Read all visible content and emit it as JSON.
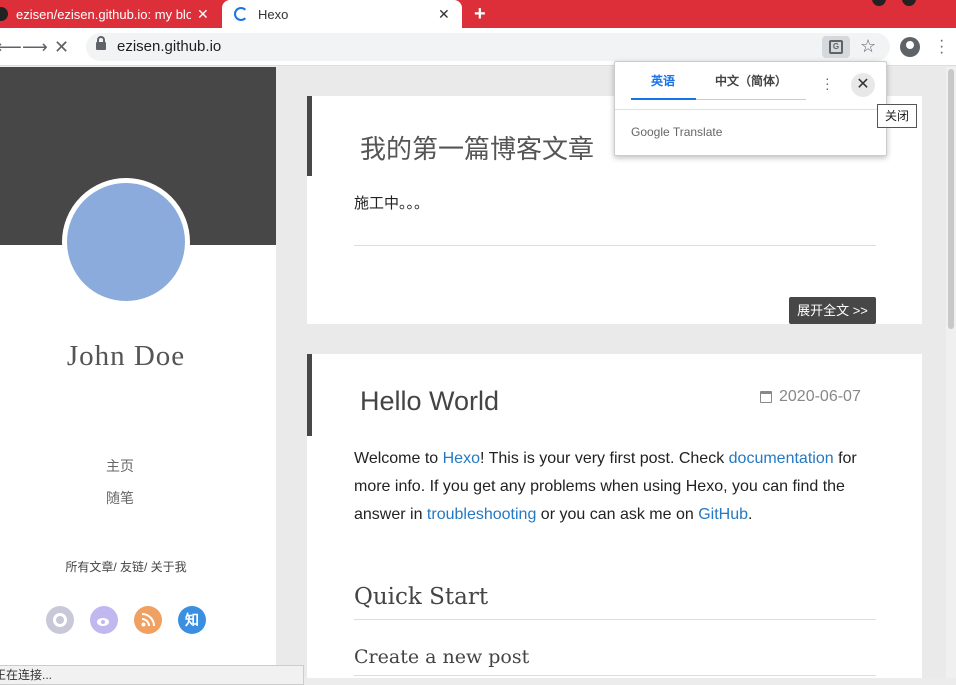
{
  "browser": {
    "tabs": [
      {
        "title": "ezisen/ezisen.github.io: my blog",
        "close": "✕"
      },
      {
        "title": "Hexo",
        "close": "✕"
      }
    ],
    "new_tab": "+",
    "url": "ezisen.github.io",
    "tab_strip_color": "#dc2f3a"
  },
  "translate_popup": {
    "source_lang": "英语",
    "target_lang": "中文（简体）",
    "brand": "Google Translate",
    "close_tooltip": "关闭"
  },
  "sidebar": {
    "name": "John  Doe",
    "nav": [
      "主页",
      "随笔"
    ],
    "links": "所有文章/  友链/  关于我",
    "social": [
      {
        "icon": "github-icon",
        "color": "#c8c8d8"
      },
      {
        "icon": "weibo-icon",
        "color": "#c2b8f0"
      },
      {
        "icon": "rss-icon",
        "color": "#f0a060"
      },
      {
        "icon": "zhihu-icon",
        "color": "#3a8fe0",
        "label": "知"
      }
    ],
    "status_text": "正在连接..."
  },
  "posts": [
    {
      "title": "我的第一篇博客文章",
      "excerpt": "施工中。。。",
      "read_more": "展开全文 >>"
    },
    {
      "title": "Hello World",
      "date": "2020-06-07",
      "para": {
        "t1": "Welcome to ",
        "l1": "Hexo",
        "t2": "! This is your very first post. Check ",
        "l2": "documentation",
        "t3": " for more info. If you get any problems when using Hexo, you can find the answer in ",
        "l3": "troubleshooting",
        "t4": " or you can ask me on ",
        "l4": "GitHub",
        "t5": "."
      },
      "h_quick": "Quick Start",
      "h_create": "Create a new post"
    }
  ]
}
